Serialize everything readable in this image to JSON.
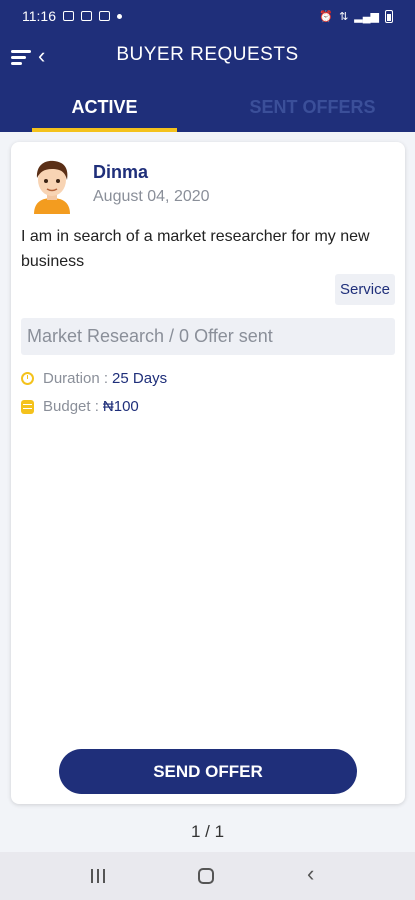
{
  "status_bar": {
    "time": "11:16"
  },
  "app_bar": {
    "title": "BUYER REQUESTS"
  },
  "tabs": [
    {
      "label": "ACTIVE",
      "active": true
    },
    {
      "label": "SENT OFFERS",
      "active": false
    }
  ],
  "request": {
    "buyer_name": "Dinma",
    "date": "August 04, 2020",
    "description": "I am in search of a market researcher for my new business",
    "type": "Service",
    "offers_summary": "Market Research / 0 Offer sent",
    "duration_label": "Duration :",
    "duration_value": "25 Days",
    "budget_label": "Budget :",
    "budget_value": "₦100"
  },
  "actions": {
    "send_offer_label": "SEND OFFER"
  },
  "pagination": {
    "text": "1 / 1"
  },
  "colors": {
    "primary": "#1f2f7a",
    "accent": "#f4c21c",
    "muted": "#8a8f99"
  }
}
